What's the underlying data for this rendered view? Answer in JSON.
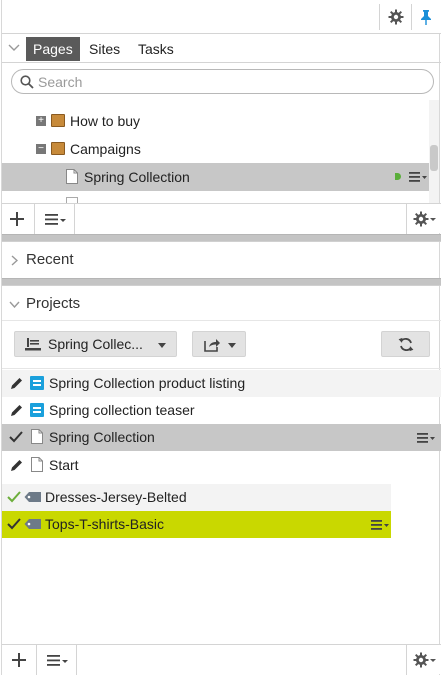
{
  "tabs": [
    {
      "label": "Pages",
      "active": true
    },
    {
      "label": "Sites",
      "active": false
    },
    {
      "label": "Tasks",
      "active": false
    }
  ],
  "search": {
    "placeholder": "Search"
  },
  "tree": {
    "items": [
      {
        "label": "How to buy",
        "expander": "+"
      },
      {
        "label": "Campaigns",
        "expander": "−"
      },
      {
        "label": "Spring Collection",
        "selected": true
      }
    ]
  },
  "sections": {
    "recent": "Recent",
    "projects": "Projects"
  },
  "project": {
    "selector_label": "Spring Collec...",
    "items": [
      {
        "label": "Spring Collection product listing",
        "status": "edit",
        "type": "blue-doc"
      },
      {
        "label": "Spring collection teaser",
        "status": "edit",
        "type": "blue-doc"
      },
      {
        "label": "Spring Collection",
        "status": "check",
        "type": "page",
        "selected": true
      },
      {
        "label": "Start",
        "status": "edit",
        "type": "page"
      }
    ],
    "tags": [
      {
        "label": "Dresses-Jersey-Belted",
        "status": "check"
      },
      {
        "label": "Tops-T-shirts-Basic",
        "status": "check",
        "highlighted": true
      }
    ]
  },
  "colors": {
    "accent": "#1a8fd8",
    "highlight": "#c9d800",
    "selected": "#c7c7c7",
    "active_tab": "#5a5a5a",
    "check": "#6cae3a"
  },
  "icons": [
    "gear-icon",
    "pin-icon",
    "search-icon",
    "folder-icon",
    "page-icon",
    "menu-icon",
    "plus-icon",
    "pencil-icon",
    "check-icon",
    "tag-icon",
    "refresh-icon",
    "share-icon",
    "list-icon",
    "chevron-down-icon",
    "chevron-right-icon"
  ]
}
